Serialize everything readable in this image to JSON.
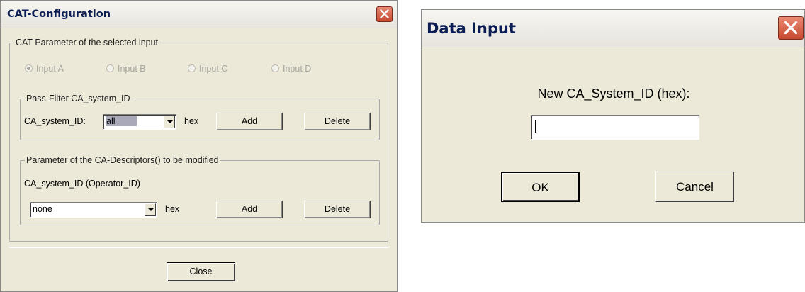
{
  "cat_window": {
    "title": "CAT-Configuration",
    "selected_input_group": "CAT Parameter of the selected input",
    "inputs": [
      {
        "label": "Input A",
        "selected": true
      },
      {
        "label": "Input B",
        "selected": false
      },
      {
        "label": "Input C",
        "selected": false
      },
      {
        "label": "Input D",
        "selected": false
      }
    ],
    "pass_filter": {
      "group_label": "Pass-Filter CA_system_ID",
      "field_label": "CA_system_ID:",
      "combo_value": "all",
      "unit": "hex",
      "add_label": "Add",
      "delete_label": "Delete"
    },
    "descriptors": {
      "group_label": "Parameter of the CA-Descriptors() to be modified",
      "field_label": "CA_system_ID (Operator_ID)",
      "combo_value": "none",
      "unit": "hex",
      "add_label": "Add",
      "delete_label": "Delete"
    },
    "close_label": "Close"
  },
  "data_input": {
    "title": "Data Input",
    "prompt": "New CA_System_ID (hex):",
    "value": "",
    "ok_label": "OK",
    "cancel_label": "Cancel"
  },
  "colors": {
    "dialog_bg": "#ece9d8",
    "close_button": "#d9553b",
    "title_text": "#0b1d52"
  }
}
